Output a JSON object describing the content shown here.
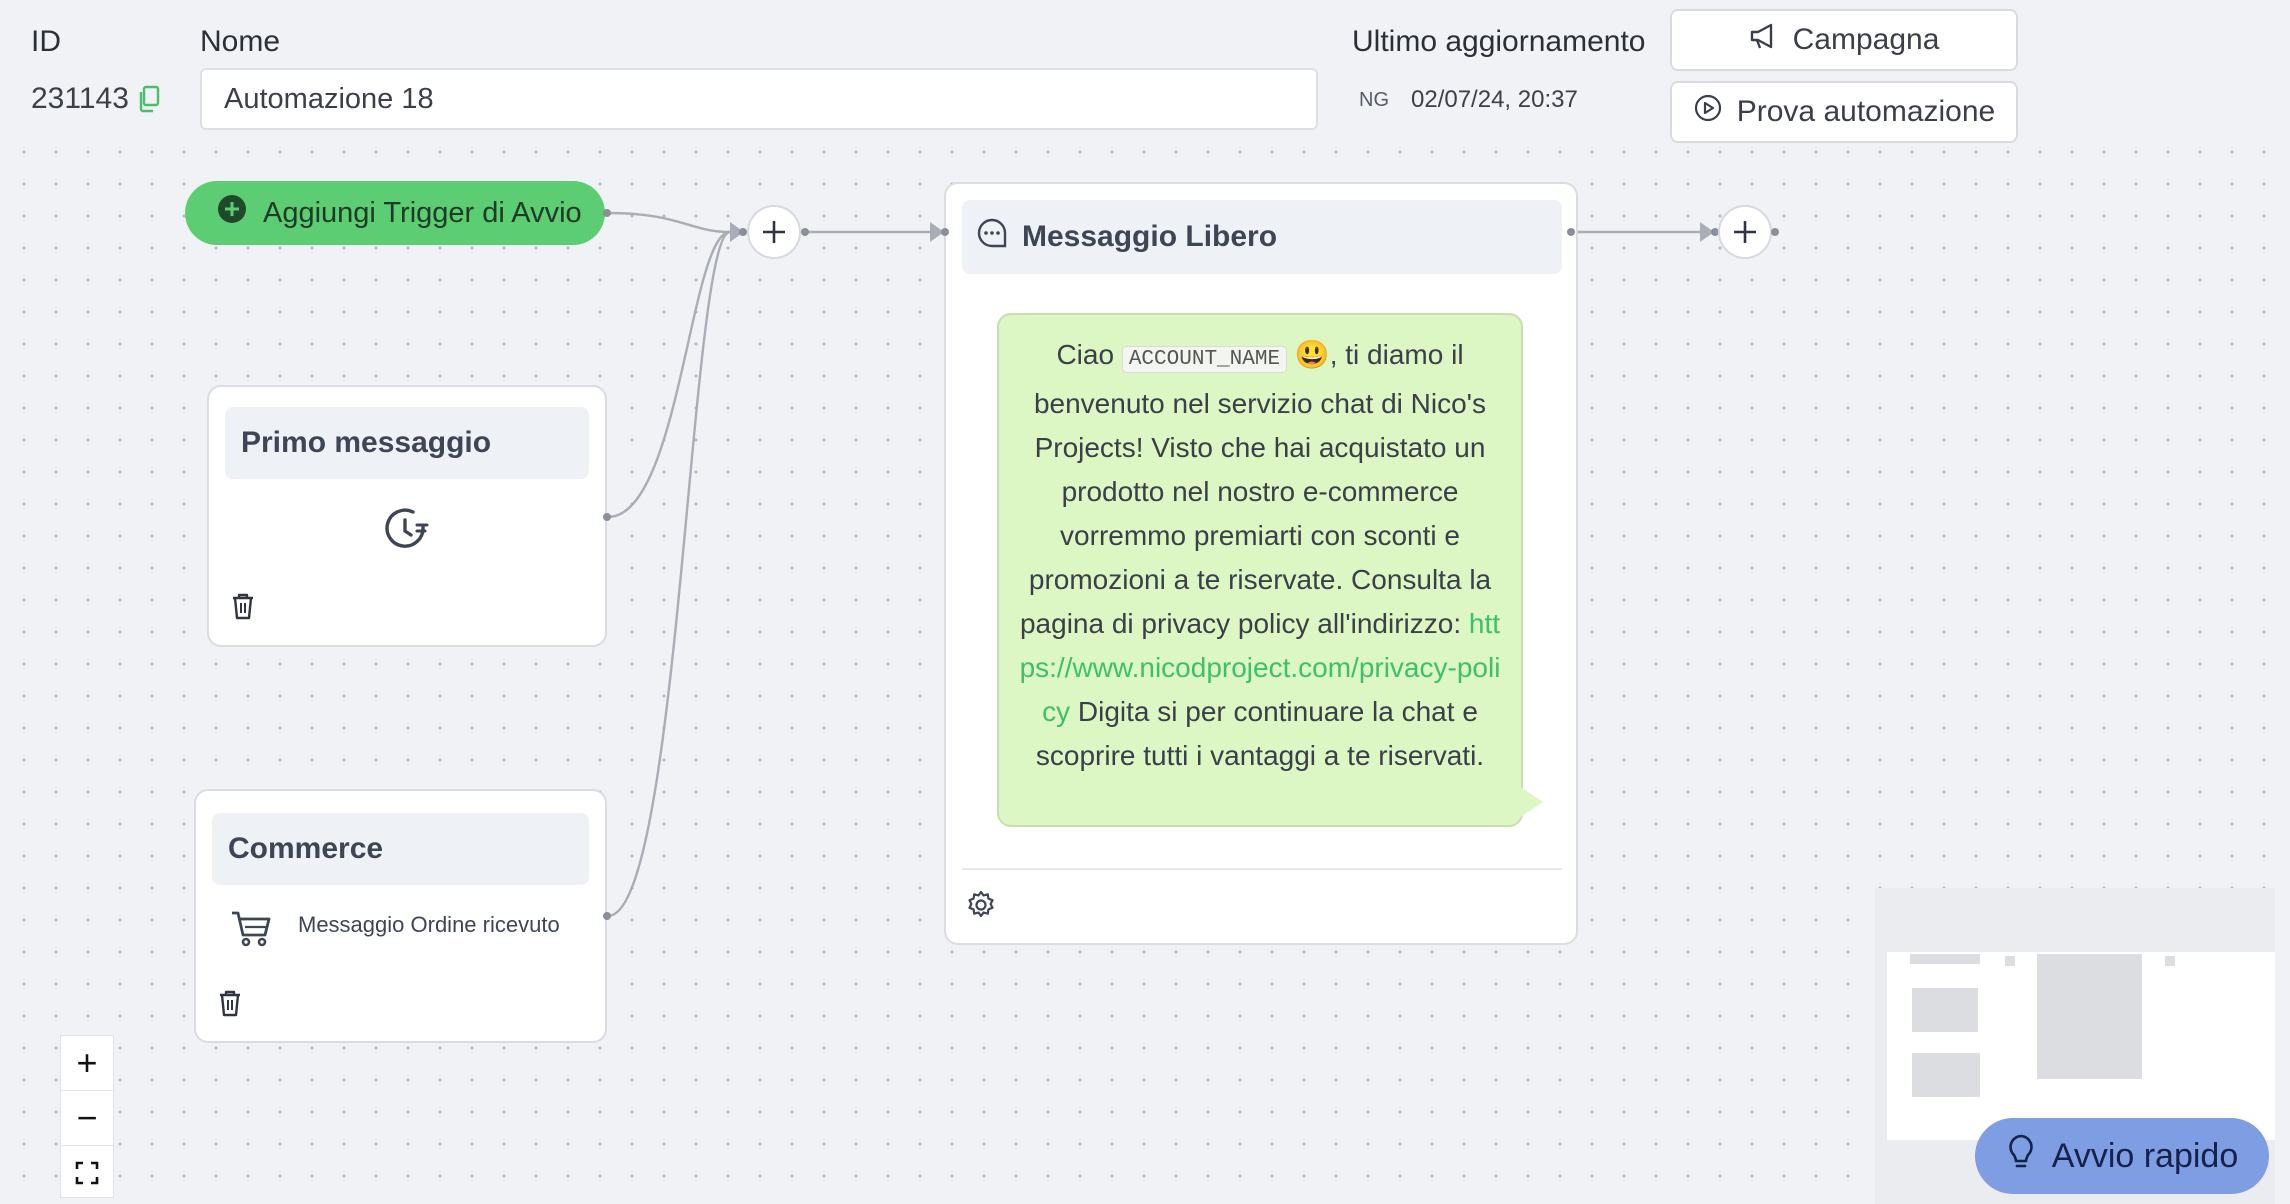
{
  "header": {
    "id_label": "ID",
    "id_value": "231143",
    "name_label": "Nome",
    "name_value": "Automazione 18",
    "updated_label": "Ultimo aggiornamento",
    "updated_user": "NG",
    "updated_date": "02/07/24, 20:37",
    "campaign_button": "Campagna",
    "test_button": "Prova automazione"
  },
  "canvas": {
    "add_trigger": "Aggiungi Trigger di Avvio",
    "triggers": [
      {
        "title": "Primo messaggio",
        "icon": "clock-rotate-icon"
      },
      {
        "title": "Commerce",
        "icon": "cart-icon",
        "subtitle": "Messaggio Ordine ricevuto"
      }
    ],
    "message_node": {
      "title": "Messaggio Libero",
      "greeting": "Ciao",
      "variable": "ACCOUNT_NAME",
      "emoji": "😃",
      "body_part1": ", ti diamo il benvenuto nel servizio chat di Nico's Projects! Visto che hai acquistato un prodotto nel nostro e-commerce vorremmo premiarti con sconti e promozioni a te riservate. Consulta la pagina di privacy policy all'indirizzo:",
      "link": "https://www.nicodproject.com/privacy-policy",
      "body_part2": "Digita si per continuare la chat e scoprire tutti i vantaggi a te riservati."
    }
  },
  "controls": {
    "zoom_in": "+",
    "zoom_out": "−",
    "fit_view": "fit"
  },
  "quick_start": "Avvio rapido",
  "colors": {
    "trigger_green": "#5ccd72",
    "bubble_green": "#dcf6c4",
    "link_green": "#3fbf6a",
    "quick_start_blue": "#7f9de3"
  }
}
